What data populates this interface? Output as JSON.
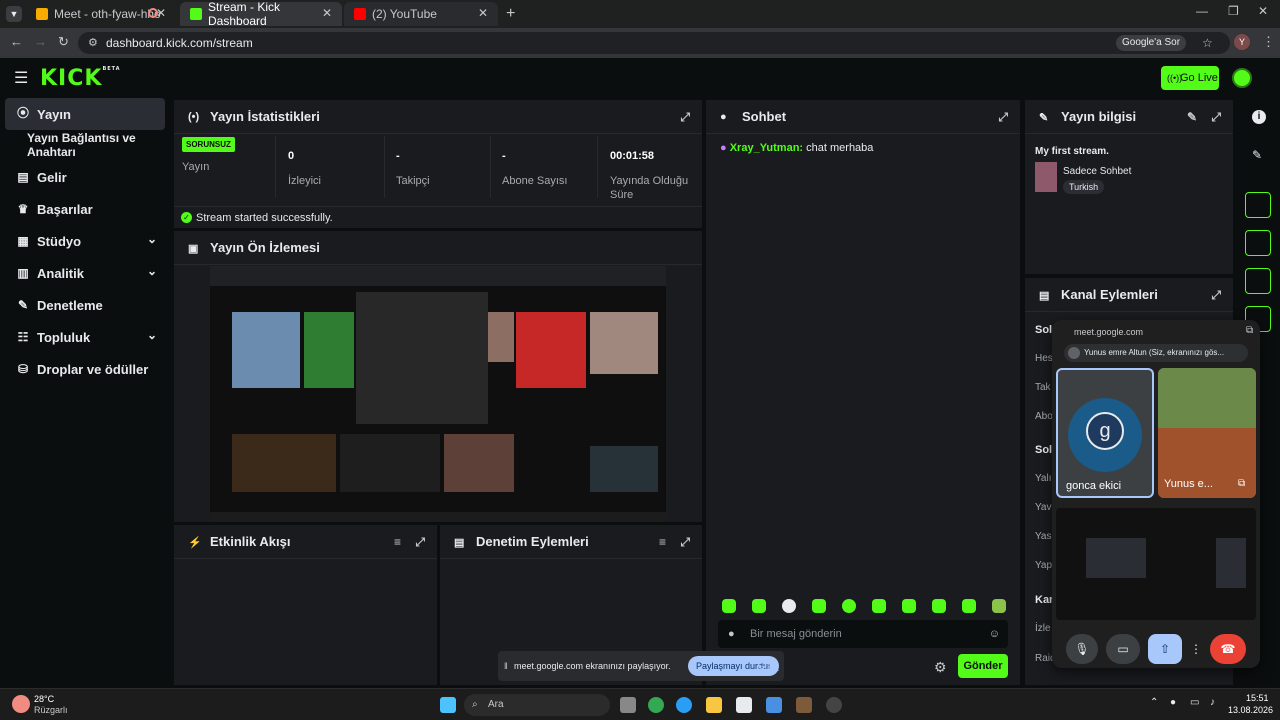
{
  "browser": {
    "tabs": [
      {
        "title": "Meet - oth-fyaw-hho"
      },
      {
        "title": "Stream - Kick Dashboard"
      },
      {
        "title": "(2) YouTube"
      }
    ],
    "url": "dashboard.kick.com/stream",
    "google_search": "Google'a Sor",
    "profile_initial": "Y"
  },
  "app": {
    "logo": "KICK",
    "logo_badge": "BETA",
    "go_live": "Go Live",
    "sidebar": [
      {
        "label": "Yayın",
        "icon": "broadcast-icon",
        "active": true
      },
      {
        "label": "Yayın Bağlantısı ve Anahtarı",
        "icon": "",
        "sub": true
      },
      {
        "label": "Gelir",
        "icon": "revenue-icon"
      },
      {
        "label": "Başarılar",
        "icon": "trophy-icon"
      },
      {
        "label": "Stüdyo",
        "icon": "studio-icon",
        "chevron": true
      },
      {
        "label": "Analitik",
        "icon": "analytics-icon",
        "chevron": true
      },
      {
        "label": "Denetleme",
        "icon": "wrench-icon"
      },
      {
        "label": "Topluluk",
        "icon": "community-icon",
        "chevron": true
      },
      {
        "label": "Droplar ve ödüller",
        "icon": "drops-icon"
      }
    ]
  },
  "stats_panel": {
    "title": "Yayın İstatistikleri",
    "status_badge": "SORUNSUZ",
    "stats": [
      {
        "value": "",
        "label": "Yayın"
      },
      {
        "value": "0",
        "label": "İzleyici"
      },
      {
        "value": "-",
        "label": "Takipçi"
      },
      {
        "value": "-",
        "label": "Abone Sayısı"
      },
      {
        "value": "00:01:58",
        "label": "Yayında Olduğu Süre"
      }
    ],
    "success_msg": "Stream started successfully."
  },
  "preview_panel": {
    "title": "Yayın Ön İzlemesi"
  },
  "events_panel": {
    "title": "Etkinlik Akışı"
  },
  "moderation_panel": {
    "title": "Denetim Eylemleri"
  },
  "chat_panel": {
    "title": "Sohbet",
    "messages": [
      {
        "user": "Xray_Yutman:",
        "text": " chat merhaba"
      }
    ],
    "input_placeholder": "Bir mesaj gönderin",
    "send": "Gönder"
  },
  "info_panel": {
    "title": "Yayın bilgisi",
    "stream_title": "My first stream.",
    "category": "Sadece Sohbet",
    "tag": "Turkish"
  },
  "channel_actions": {
    "title": "Kanal Eylemleri",
    "items": [
      "Sol",
      "Hes",
      "Tak",
      "Abo",
      "Sol",
      "Yalı",
      "Yav",
      "Yas",
      "Yap",
      "Kar",
      "İzle",
      "Raid"
    ]
  },
  "meet": {
    "host": "meet.google.com",
    "presenter": "Yunus emre Altun (Siz, ekranınızı gös...",
    "tile1_name": "gonca ekici",
    "tile1_initial": "g",
    "tile2_name": "Yunus e..."
  },
  "share_bar": {
    "text": "meet.google.com ekranınızı paylaşıyor.",
    "stop": "Paylaşmayı durdur",
    "hide": "Gizle"
  },
  "taskbar": {
    "temp": "28°C",
    "weather": "Rüzgarlı",
    "search": "Ara",
    "time": "15:51",
    "date": "13.08.2026"
  },
  "colors": {
    "accent": "#53fc18",
    "panel": "#191b1f",
    "bg": "#0b0e0f",
    "hangup": "#ea4335"
  }
}
